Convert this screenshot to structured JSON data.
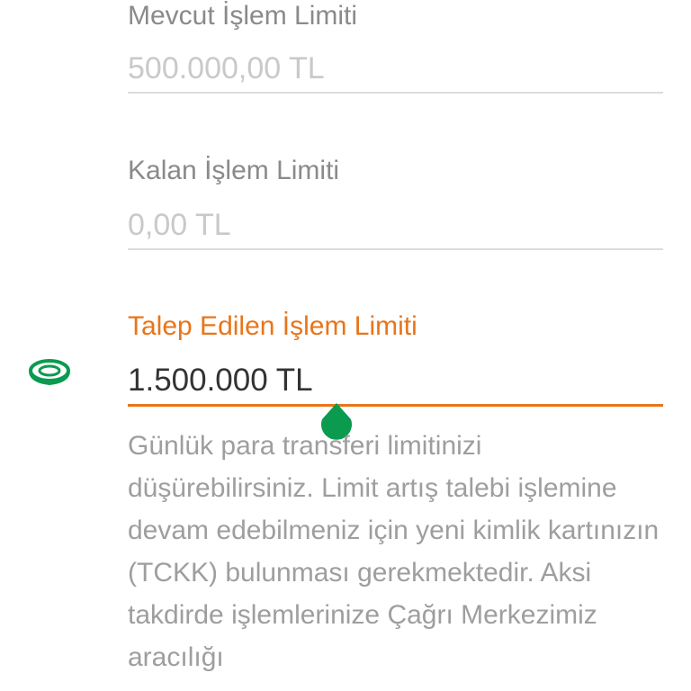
{
  "fields": {
    "current_limit": {
      "label": "Mevcut İşlem Limiti",
      "value": "500.000,00 TL"
    },
    "remaining_limit": {
      "label": "Kalan İşlem Limiti",
      "value": "0,00 TL"
    },
    "requested_limit": {
      "label": "Talep Edilen İşlem Limiti",
      "value": "1.500.000 TL"
    }
  },
  "helper_text": "Günlük para transferi limitinizi düşürebilirsiniz. Limit artış talebi işlemine devam edebilmeniz için yeni kimlik kartınızın (TCKK) bulunması gerekmektedir. Aksi takdirde işlemlerinize Çağrı Merkezimiz aracılığı",
  "colors": {
    "accent": "#e8751a",
    "cursor_handle": "#0a9b4f",
    "label": "#8a8a8a",
    "disabled_value": "#c9c9c9"
  },
  "icons": {
    "side_icon": "money-coin-icon",
    "cursor": "text-cursor-handle-icon"
  }
}
